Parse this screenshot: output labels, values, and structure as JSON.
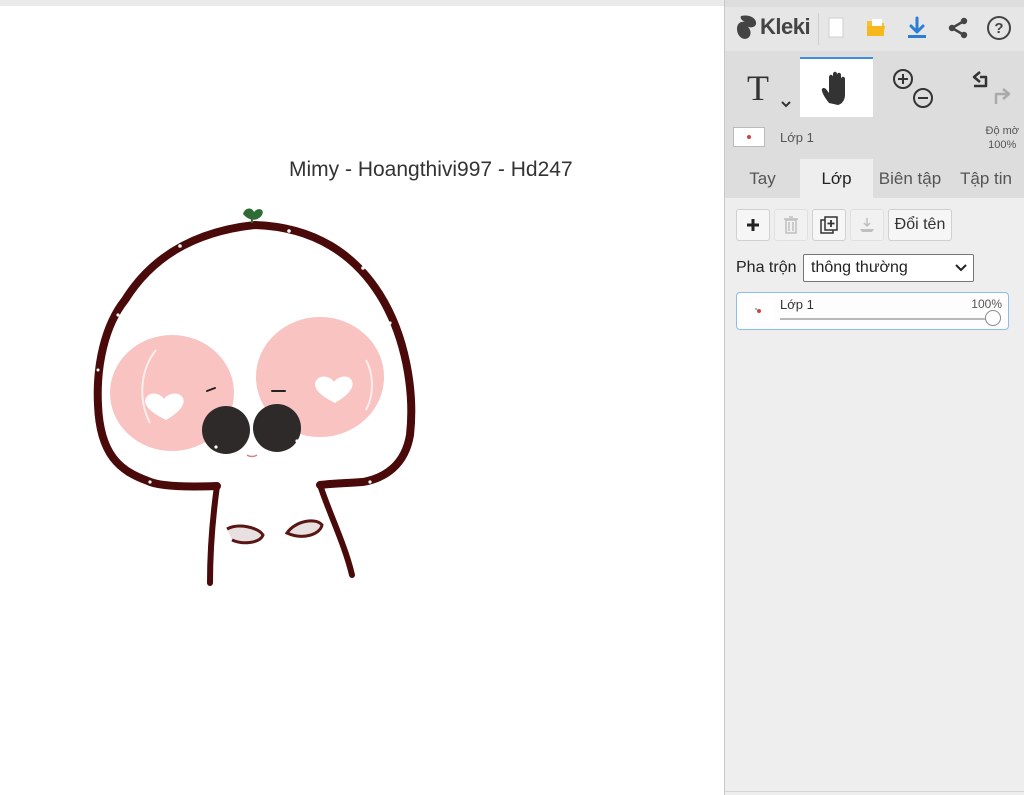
{
  "canvas": {
    "caption": "Mimy - Hoangthivi997 - Hd247"
  },
  "toolbar": {
    "logo_text": "Kleki",
    "icons": [
      "kleki-logo-icon",
      "new-file-icon",
      "open-file-icon",
      "download-icon",
      "share-icon",
      "help-icon"
    ],
    "accent_color": "#2a7fd4"
  },
  "tools": {
    "items": [
      "text-tool-icon",
      "hand-tool-icon",
      "zoom-in-icon",
      "zoom-out-icon",
      "undo-icon",
      "redo-icon"
    ],
    "active": "hand-tool-icon"
  },
  "layer_info": {
    "name": "Lớp 1",
    "opacity_label": "Độ mờ",
    "opacity_value": "100%"
  },
  "tabs": [
    {
      "label": "Tay",
      "active": false
    },
    {
      "label": "Lớp",
      "active": true
    },
    {
      "label": "Biên tập",
      "active": false
    },
    {
      "label": "Tập tin",
      "active": false
    }
  ],
  "layers_panel": {
    "buttons": [
      "add-layer-icon",
      "delete-layer-icon",
      "duplicate-layer-icon",
      "merge-down-icon"
    ],
    "rename_label": "Đổi tên",
    "blend_label": "Pha trộn",
    "blend_value": "thông thường",
    "layers": [
      {
        "name": "Lớp 1",
        "opacity": "100%",
        "opacity_fraction": 1.0
      }
    ]
  }
}
